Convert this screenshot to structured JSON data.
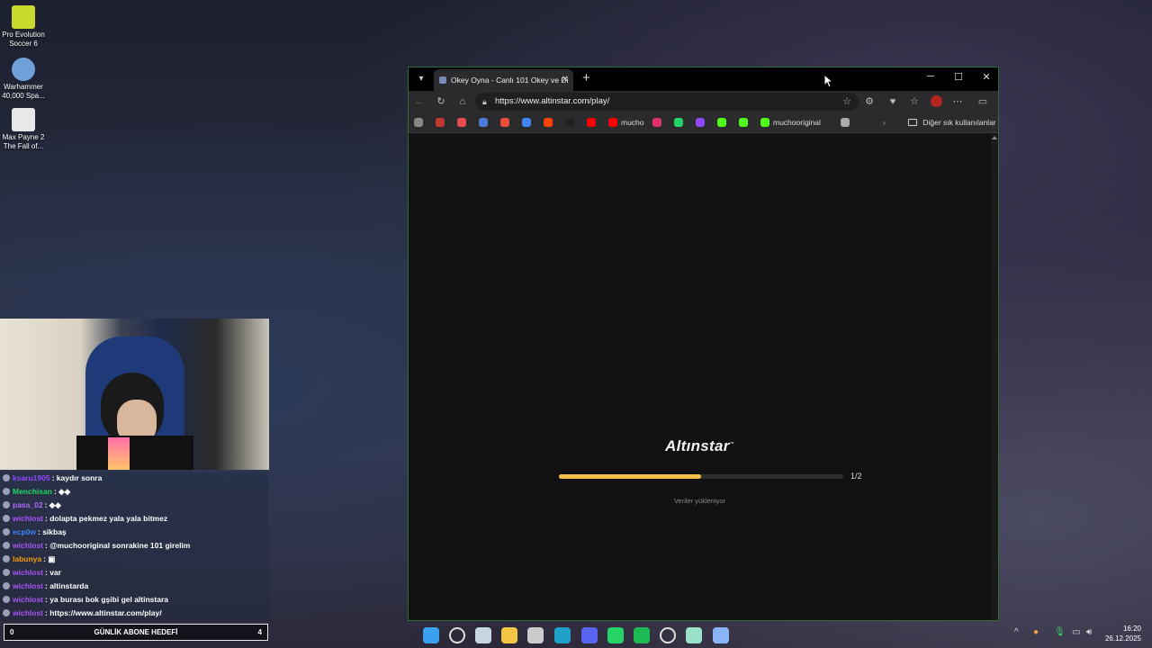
{
  "desktop": {
    "icons": [
      {
        "label": "Pro Evolution Soccer 6",
        "color": "#c8d92e"
      },
      {
        "label": "Warhammer 40,000 Spa...",
        "color": "#6fa0d8"
      },
      {
        "label": "Max Payne 2 The Fall of...",
        "color": "#e8e8e8"
      }
    ]
  },
  "chat": {
    "messages": [
      {
        "user": "ksaru1905",
        "text": ": kaydır sonra",
        "color": "#9147ff"
      },
      {
        "user": "Menchisan",
        "text": ": ◆◆",
        "color": "#1ed760"
      },
      {
        "user": "pasa_02",
        "text": ": ◆◆",
        "color": "#b26bff"
      },
      {
        "user": "wichlost",
        "text": ": dolapta pekmez yala yala bitmez",
        "color": "#a855f7"
      },
      {
        "user": "ecp0w",
        "text": ": sikbaş",
        "color": "#3b82f6"
      },
      {
        "user": "wichlost",
        "text": ": @muchooriginal sonrakine 101 girelim",
        "color": "#a855f7"
      },
      {
        "user": "labunya",
        "text": ": ▣",
        "color": "#f59e0b"
      },
      {
        "user": "wichlost",
        "text": ": var",
        "color": "#a855f7"
      },
      {
        "user": "wichlost",
        "text": ": altinstarda",
        "color": "#a855f7"
      },
      {
        "user": "wichlost",
        "text": ": ya burası bok gşibi gel altinstara",
        "color": "#a855f7"
      },
      {
        "user": "wichlost",
        "text": ": https://www.altinstar.com/play/",
        "color": "#a855f7"
      }
    ],
    "sub_goal": {
      "left": "0",
      "title": "GÜNLİK ABONE HEDEFİ",
      "right": "4"
    }
  },
  "browser": {
    "tab_title": "Okey Oyna - Canlı 101 Okey ve Di",
    "new_tab_symbol": "+",
    "url": "https://www.altinstar.com/play/",
    "bookmarks": [
      {
        "label": "",
        "color": "#888888"
      },
      {
        "label": "",
        "color": "#c0392b"
      },
      {
        "label": "",
        "color": "#e34d4d"
      },
      {
        "label": "",
        "color": "#4a7bd8"
      },
      {
        "label": "",
        "color": "#e74c3c"
      },
      {
        "label": "",
        "color": "#4285f4"
      },
      {
        "label": "",
        "color": "#ff4500"
      },
      {
        "label": "",
        "color": "#222222"
      },
      {
        "label": "",
        "color": "#ff0000"
      },
      {
        "label": "mucho",
        "color": "#ff0000"
      },
      {
        "label": "",
        "color": "#e1306c"
      },
      {
        "label": "",
        "color": "#25d366"
      },
      {
        "label": "",
        "color": "#9146ff"
      },
      {
        "label": "",
        "color": "#53fc18"
      },
      {
        "label": "",
        "color": "#53fc18"
      },
      {
        "label": "muchooriginal",
        "color": "#53fc18"
      },
      {
        "label": "",
        "color": "#aaaaaa"
      }
    ],
    "other_bookmarks": "Diğer sık kullanılanlar",
    "page": {
      "logo": "Altınstar",
      "logo_tm": "™",
      "progress": 0.5,
      "progress_count": "1/2",
      "loading_text": "Veriler yükleniyor",
      "accent": "#f2c04a"
    }
  },
  "taskbar": {
    "apps": [
      {
        "name": "start",
        "color": "#3aa0f0"
      },
      {
        "name": "search",
        "color": "#dddddd"
      },
      {
        "name": "steam",
        "color": "#c7d5e0"
      },
      {
        "name": "file-explorer",
        "color": "#f4c542"
      },
      {
        "name": "store",
        "color": "#cccccc"
      },
      {
        "name": "edge",
        "color": "#1fa0c8"
      },
      {
        "name": "discord",
        "color": "#5865f2"
      },
      {
        "name": "whatsapp",
        "color": "#25d366"
      },
      {
        "name": "spotify",
        "color": "#1db954"
      },
      {
        "name": "obs",
        "color": "#dddddd"
      },
      {
        "name": "refresh",
        "color": "#9be0c8"
      },
      {
        "name": "app",
        "color": "#8ab4f8"
      }
    ],
    "time": "16:20",
    "date": "26.12.2025"
  }
}
